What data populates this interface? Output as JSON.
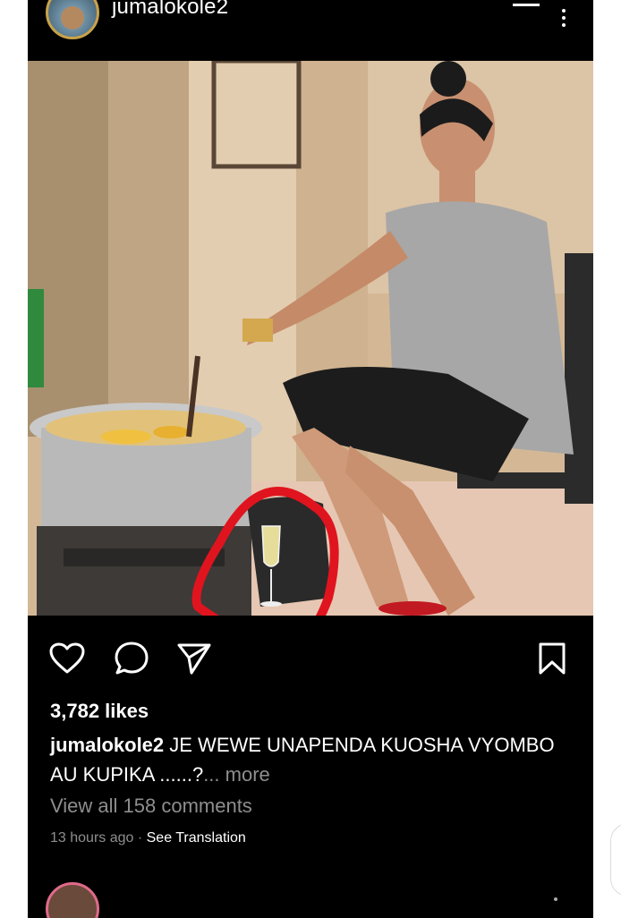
{
  "post": {
    "username": "jumalokole2",
    "likes": "3,782 likes",
    "caption_user": "jumalokole2",
    "caption_text": " JE WEWE UNAPENDA KUOSHA VYOMBO AU KUPIKA ......?",
    "caption_more": "... more",
    "view_comments": "View all 158 comments",
    "time": "13 hours ago",
    "separator": " · ",
    "see_translation": "See Translation"
  },
  "icons": {
    "like": "heart-icon",
    "comment": "comment-icon",
    "share": "send-icon",
    "save": "bookmark-icon",
    "menu": "more-options-icon"
  },
  "colors": {
    "background": "#000000",
    "text": "#ffffff",
    "secondary_text": "#8e8e8e",
    "annotation": "#e0141e"
  }
}
